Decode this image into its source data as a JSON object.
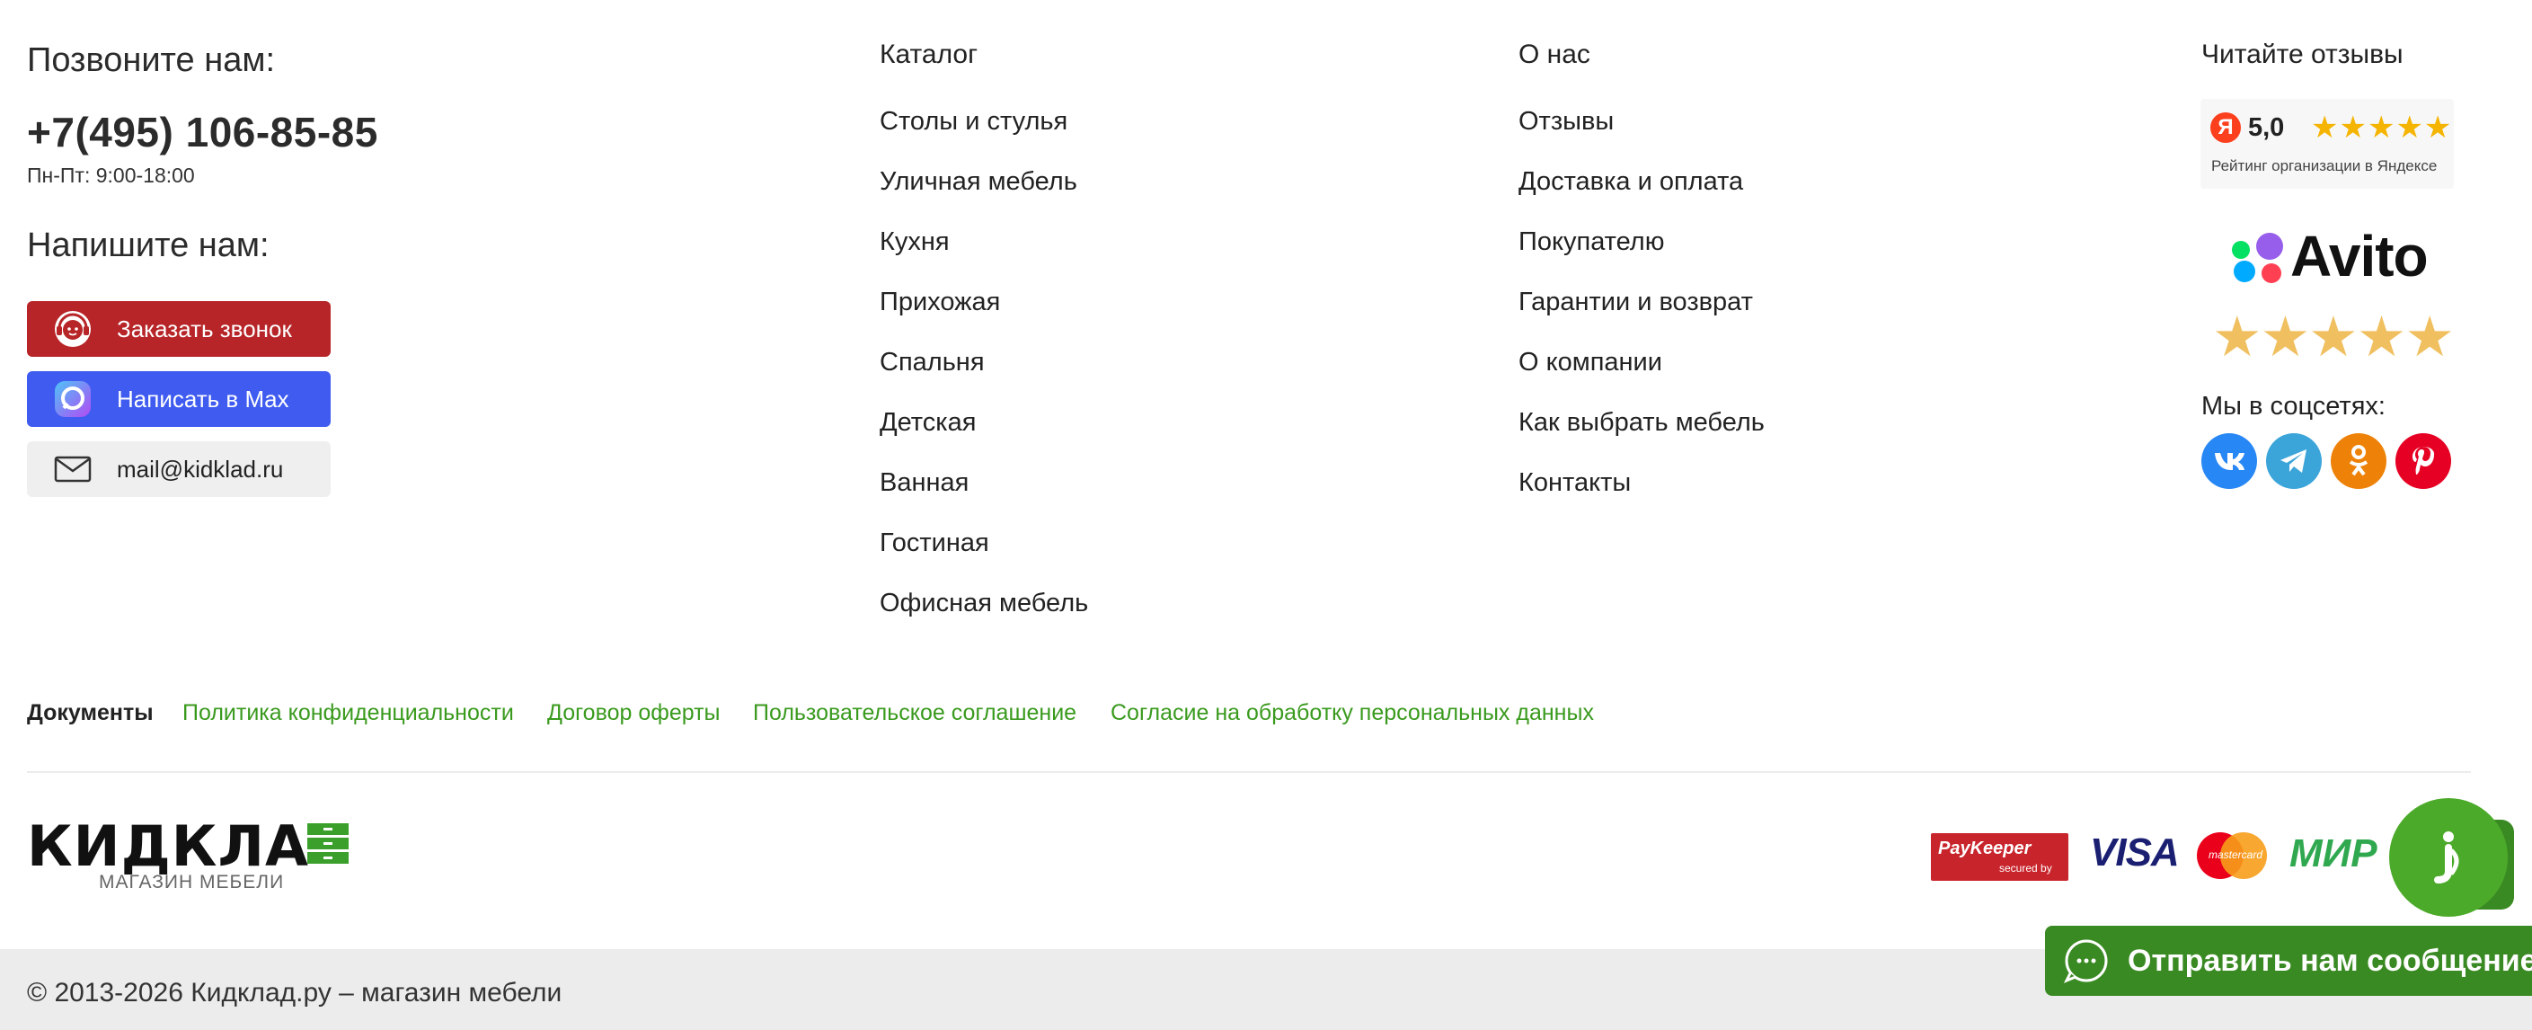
{
  "contact": {
    "call_heading": "Позвоните нам:",
    "phone": "+7(495) 106-85-85",
    "hours": "Пн-Пт: 9:00-18:00",
    "write_heading": "Напишите нам:",
    "order_call": "Заказать звонок",
    "max_label": "Написать в Max",
    "email": "mail@kidklad.ru"
  },
  "catalog": {
    "title": "Каталог",
    "items": [
      "Столы и стулья",
      "Уличная мебель",
      "Кухня",
      "Прихожая",
      "Спальня",
      "Детская",
      "Ванная",
      "Гостиная",
      "Офисная мебель"
    ]
  },
  "about": {
    "title": "О нас",
    "items": [
      "Отзывы",
      "Доставка и оплата",
      "Покупателю",
      "Гарантии и возврат",
      "О компании",
      "Как выбрать мебель",
      "Контакты"
    ]
  },
  "reviews": {
    "title": "Читайте отзывы",
    "yandex_letter": "Я",
    "yandex_rating": "5,0",
    "yandex_caption": "Рейтинг организации в Яндексе",
    "avito_text": "Avito",
    "social_title": "Мы в соцсетях:",
    "colors": {
      "vk": "#2787f5",
      "telegram": "#3ba5da",
      "ok": "#ee8208",
      "pinterest": "#e60023"
    }
  },
  "documents": {
    "label": "Документы",
    "links": [
      "Политика конфиденциальности",
      "Договор оферты",
      "Пользовательское соглашение",
      "Согласие на обработку персональных данных"
    ]
  },
  "brand": {
    "logo_text": "КИДКЛА",
    "tagline": "МАГАЗИН МЕБЕЛИ"
  },
  "payments": {
    "paykeeper": "PayKeeper",
    "paykeeper_sub": "secured by",
    "visa": "VISA",
    "mastercard": "mastercard",
    "mir": "МИР"
  },
  "footer": {
    "copyright": "© 2013-2026 Кидклад.ру – магазин мебели",
    "message_button": "Отправить нам сообщение"
  }
}
